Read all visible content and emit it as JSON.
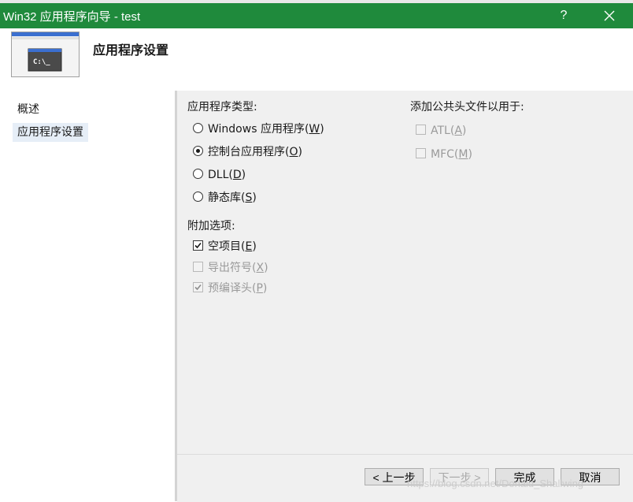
{
  "window": {
    "title": "Win32 应用程序向导 - test",
    "help_label": "?",
    "accent_color": "#1f8a3c"
  },
  "banner": {
    "title": "应用程序设置",
    "image_text": "C:\\_"
  },
  "sidebar": {
    "items": [
      {
        "label": "概述"
      },
      {
        "label": "应用程序设置"
      }
    ]
  },
  "app_type": {
    "label": "应用程序类型:",
    "options": [
      {
        "text": "Windows 应用程序(",
        "key": "W",
        "tail": ")",
        "selected": false
      },
      {
        "text": "控制台应用程序(",
        "key": "O",
        "tail": ")",
        "selected": true
      },
      {
        "text": "DLL(",
        "key": "D",
        "tail": ")",
        "selected": false
      },
      {
        "text": "静态库(",
        "key": "S",
        "tail": ")",
        "selected": false
      }
    ]
  },
  "common_headers": {
    "label": "添加公共头文件以用于:",
    "options": [
      {
        "text": "ATL(",
        "key": "A",
        "tail": ")",
        "checked": false,
        "enabled": false
      },
      {
        "text": "MFC(",
        "key": "M",
        "tail": ")",
        "checked": false,
        "enabled": false
      }
    ]
  },
  "additional": {
    "label": "附加选项:",
    "options": [
      {
        "text": "空项目(",
        "key": "E",
        "tail": ")",
        "checked": true,
        "enabled": true
      },
      {
        "text": "导出符号(",
        "key": "X",
        "tail": ")",
        "checked": false,
        "enabled": false
      },
      {
        "text": "预编译头(",
        "key": "P",
        "tail": ")",
        "checked": true,
        "enabled": false
      }
    ]
  },
  "footer": {
    "prev_label": "< 上一步",
    "next_label": "下一步 >",
    "finish_label": "完成",
    "cancel_label": "取消"
  },
  "watermark": "https://blog.csdn.net/Donald_Shallwing"
}
